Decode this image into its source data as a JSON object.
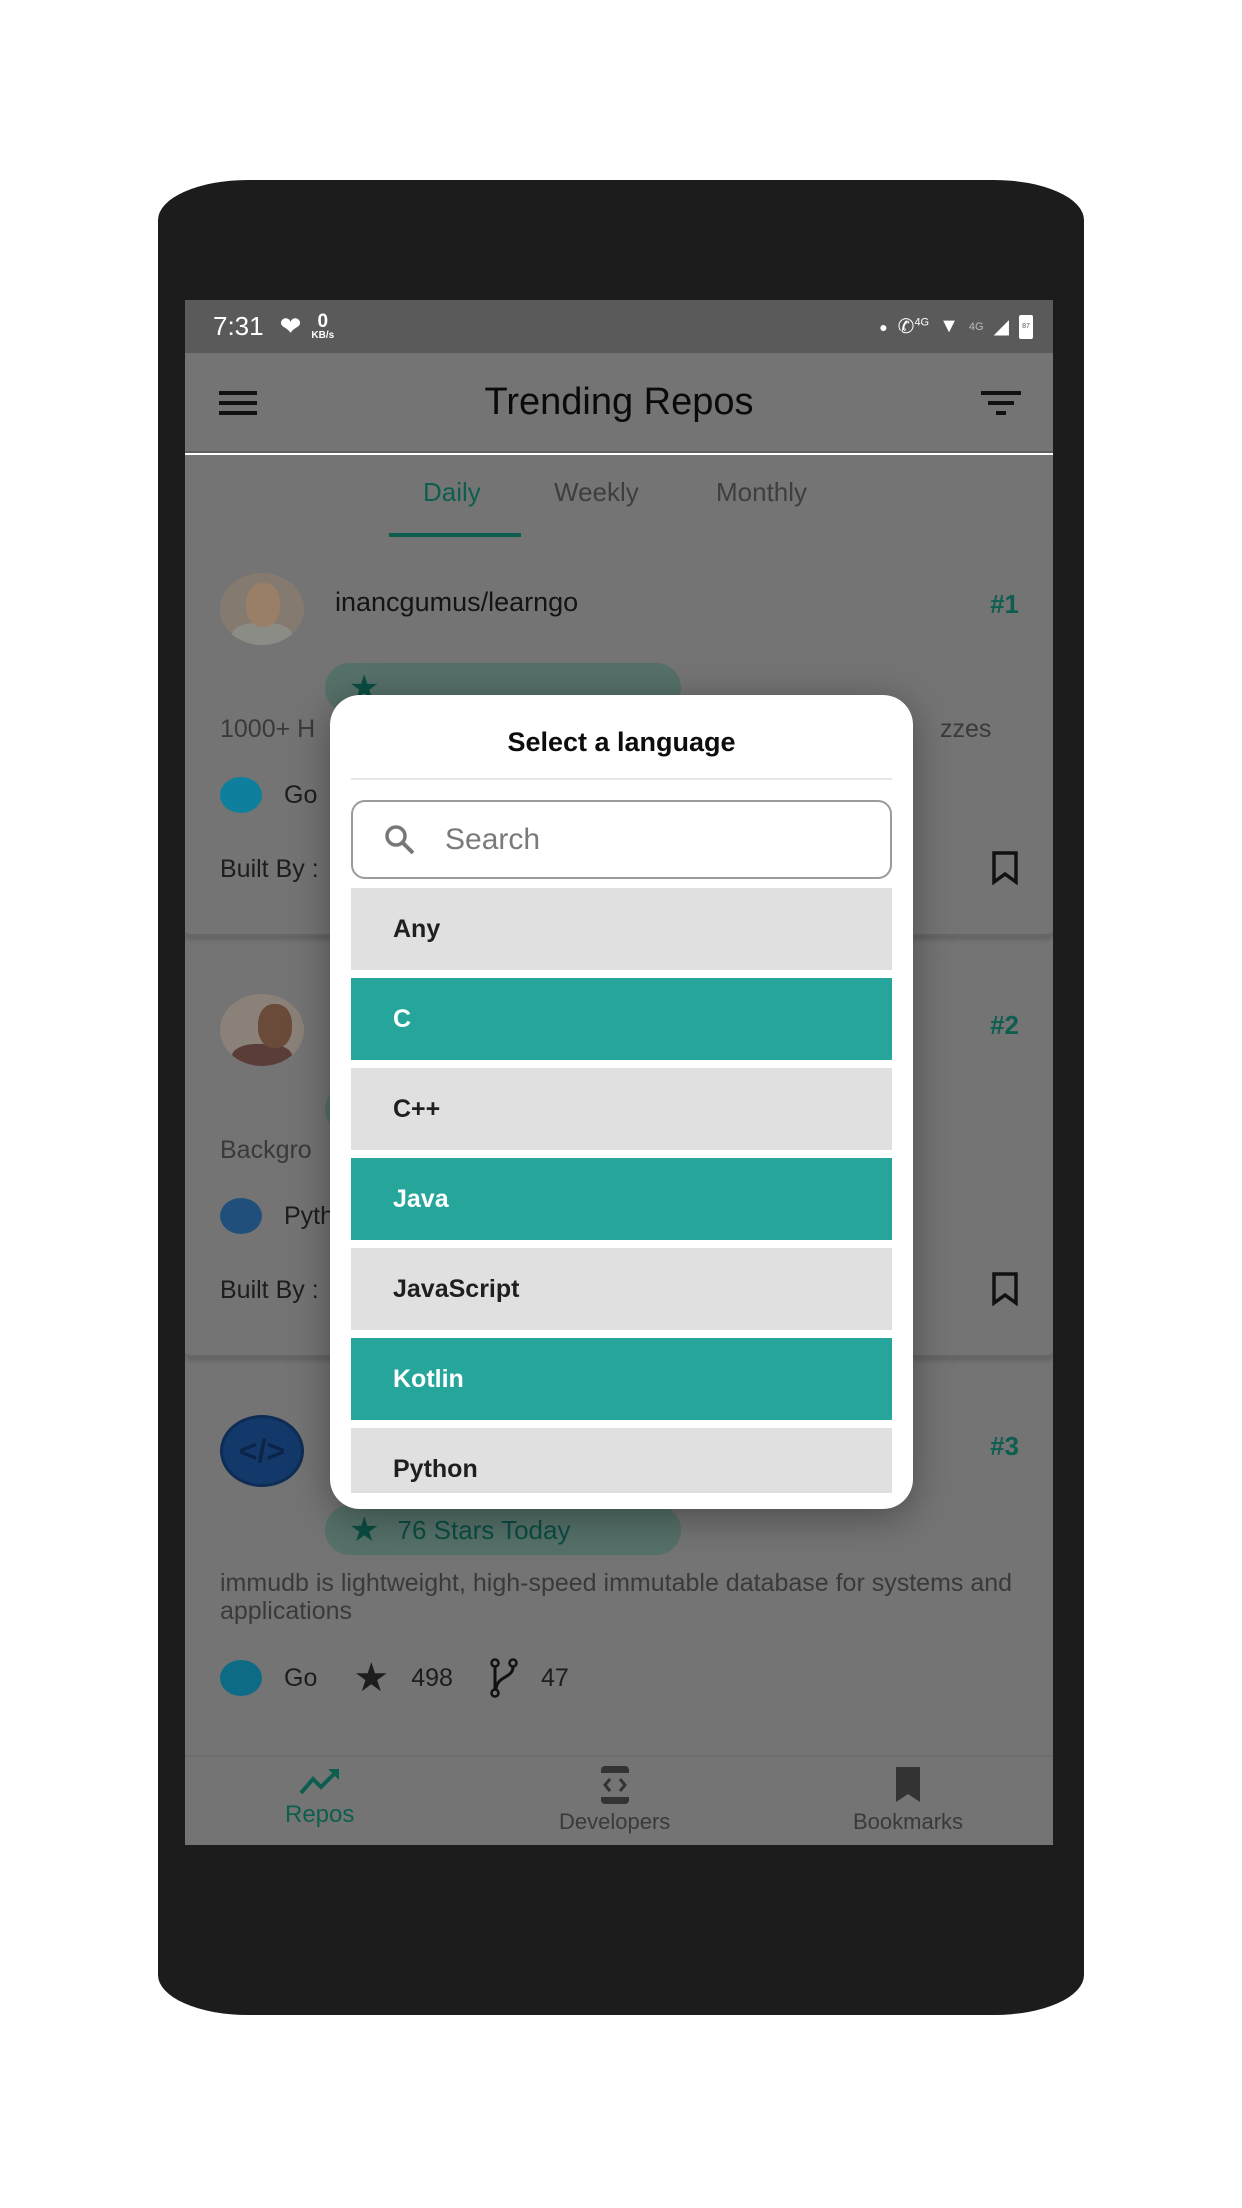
{
  "status_bar": {
    "time": "7:31",
    "net_speed_value": "0",
    "net_speed_unit": "KB/s",
    "net_label_1": "4G",
    "net_label_2": "4G",
    "battery": "87"
  },
  "app_bar": {
    "title": "Trending Repos",
    "menu_icon": "menu-icon",
    "filter_icon": "filter-icon"
  },
  "tabs": [
    {
      "label": "Daily",
      "active": true
    },
    {
      "label": "Weekly",
      "active": false
    },
    {
      "label": "Monthly",
      "active": false
    }
  ],
  "repos": [
    {
      "name": "inancgumus/learngo",
      "rank": "#1",
      "description_visible_left": "1000+ H",
      "description_visible_right": "zzes",
      "language": "Go",
      "language_color": "#00ADD8",
      "built_by_label": "Built By :"
    },
    {
      "name": "",
      "rank": "#2",
      "description_visible_left": "Backgro",
      "language": "Pyth",
      "language_color": "#3572A5",
      "built_by_label": "Built By :"
    },
    {
      "name": "",
      "rank": "#3",
      "stars_today": "76 Stars Today",
      "description": "immudb is lightweight, high-speed immutable database for systems and applications",
      "language": "Go",
      "language_color": "#00ADD8",
      "stars": "498",
      "forks": "47"
    }
  ],
  "bottom_nav": [
    {
      "label": "Repos",
      "icon": "trending-up-icon",
      "active": true
    },
    {
      "label": "Developers",
      "icon": "developer-mode-icon",
      "active": false
    },
    {
      "label": "Bookmarks",
      "icon": "bookmark-icon",
      "active": false
    }
  ],
  "dialog": {
    "title": "Select a language",
    "search_placeholder": "Search",
    "search_value": "",
    "languages": [
      {
        "label": "Any",
        "selected": false
      },
      {
        "label": "C",
        "selected": true
      },
      {
        "label": "C++",
        "selected": false
      },
      {
        "label": "Java",
        "selected": true
      },
      {
        "label": "JavaScript",
        "selected": false
      },
      {
        "label": "Kotlin",
        "selected": true
      },
      {
        "label": "Python",
        "selected": false
      }
    ]
  },
  "colors": {
    "accent": "#26a69a",
    "accent_dark": "#0e5e50",
    "item_neutral": "#e0e0e0"
  }
}
